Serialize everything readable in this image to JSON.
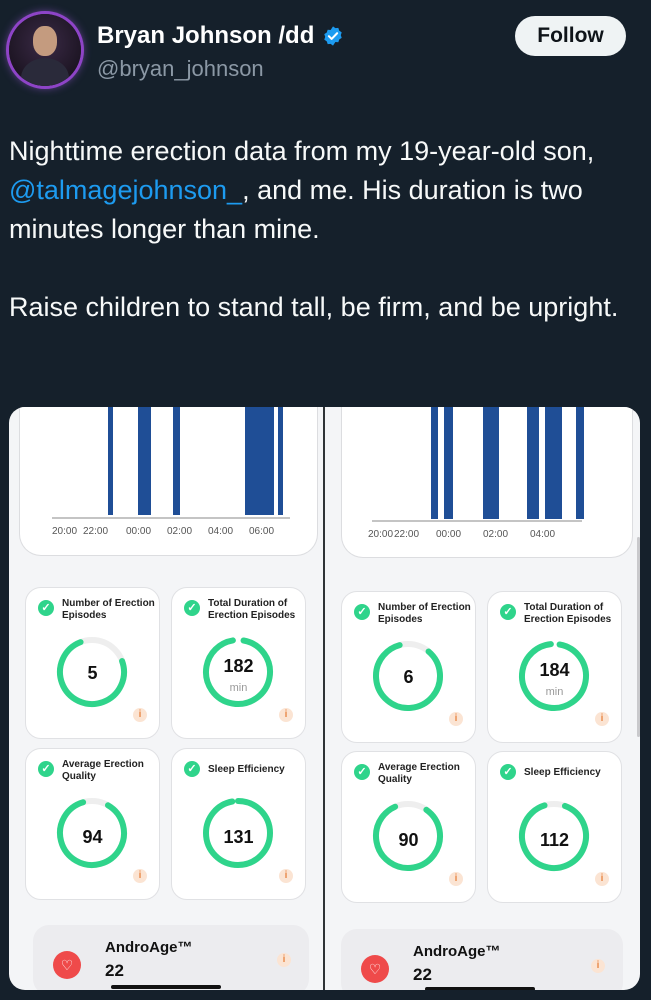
{
  "author": {
    "name": "Bryan Johnson /dd",
    "handle": "@bryan_johnson",
    "follow_label": "Follow",
    "verified_icon": "verified-badge-icon",
    "accent": "#1d9bf0"
  },
  "tweet": {
    "line1_before": "Nighttime erection data from my 19-year-old son, ",
    "mention": "@talmagejohnson_",
    "line1_after": ", and me. His duration is two minutes longer than mine.",
    "para2": "Raise children to stand tall, be firm, and be upright."
  },
  "left_panel": {
    "ticks": [
      "20:00",
      "22:00",
      "00:00",
      "02:00",
      "04:00",
      "06:00"
    ],
    "metrics": [
      {
        "title": "Number of Erection Episodes",
        "value": "5",
        "unit": ""
      },
      {
        "title": "Total Duration of Erection Episodes",
        "value": "182",
        "unit": "min"
      },
      {
        "title": "Average Erection Quality",
        "value": "94",
        "unit": ""
      },
      {
        "title": "Sleep Efficiency",
        "value": "131",
        "unit": ""
      }
    ],
    "andro_label": "AndroAge™",
    "andro_value": "22"
  },
  "right_panel": {
    "ticks": [
      "20:00",
      "22:00",
      "00:00",
      "02:00",
      "04:00"
    ],
    "metrics": [
      {
        "title": "Number of Erection Episodes",
        "value": "6",
        "unit": ""
      },
      {
        "title": "Total Duration of Erection Episodes",
        "value": "184",
        "unit": "min"
      },
      {
        "title": "Average Erection Quality",
        "value": "90",
        "unit": ""
      },
      {
        "title": "Sleep Efficiency",
        "value": "112",
        "unit": ""
      }
    ],
    "andro_label": "AndroAge™",
    "andro_value": "22"
  },
  "colors": {
    "ring": "#2fd48b",
    "bar": "#1f4e96",
    "heart": "#ef4a4a"
  }
}
